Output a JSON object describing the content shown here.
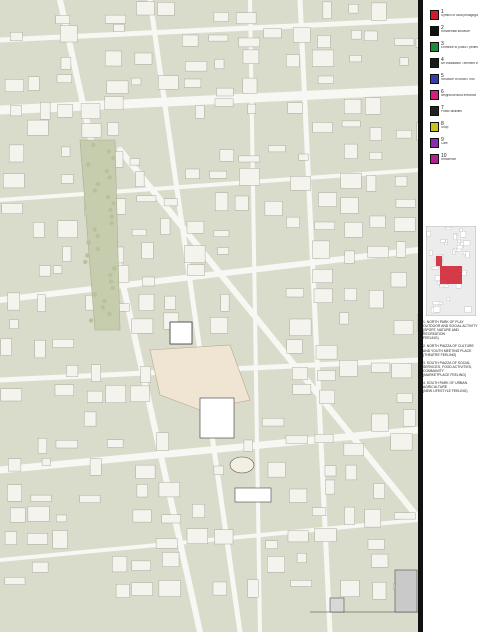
{
  "legend": {
    "items": [
      {
        "num": "1",
        "text": "Symbol of local pedagogue / The lands ... ",
        "color": "#d01b2a"
      },
      {
        "num": "2",
        "text": "Residential structure",
        "color": "#111111"
      },
      {
        "num": "3",
        "text": "Entrance to public / pedestrian",
        "color": "#1f8a3c"
      },
      {
        "num": "4",
        "text": "Art installation / element in the city",
        "color": "#1b1b1b"
      },
      {
        "num": "5",
        "text": "Structure of urban / Info",
        "color": "#3a3aa8"
      },
      {
        "num": "6",
        "text": "Neighbourhood entrance",
        "color": "#d61f7a"
      },
      {
        "num": "7",
        "text": "Public facilities",
        "color": "#222222"
      },
      {
        "num": "8",
        "text": "Shop",
        "color": "#c7c31a"
      },
      {
        "num": "9",
        "text": "Cafe",
        "color": "#8a2bb0"
      },
      {
        "num": "10",
        "text": "Residence",
        "color": "#b0228c"
      }
    ]
  },
  "notes": [
    "1. NORTH PARK OF PLAY\nOUTDOOR AND SOCIAL ACTIVITY\n(SPORT, NATURE AND RECREATION\nFEELING)",
    "2. NORTH PIAZZA OF CULTURE\nAND YOUTH MEETING PLACE\n(THEATRE FEELING)",
    "3. SOUTH PIAZZA OF SOCIAL\nSERVICES, FOOD ACTIVITIES,\nCOMMUNITY\n(MARKETPLACE FEELING)",
    "4. SOUTH PARK OF URBAN\nAGRICULTURE\n(NEW LIFESTYLE FEELING)"
  ],
  "colors": {
    "ground": "#d9dccb",
    "building": "#f4f3ee",
    "road": "#f7f7f4",
    "square": "#efe5d2",
    "accent": "#d01b2a"
  }
}
